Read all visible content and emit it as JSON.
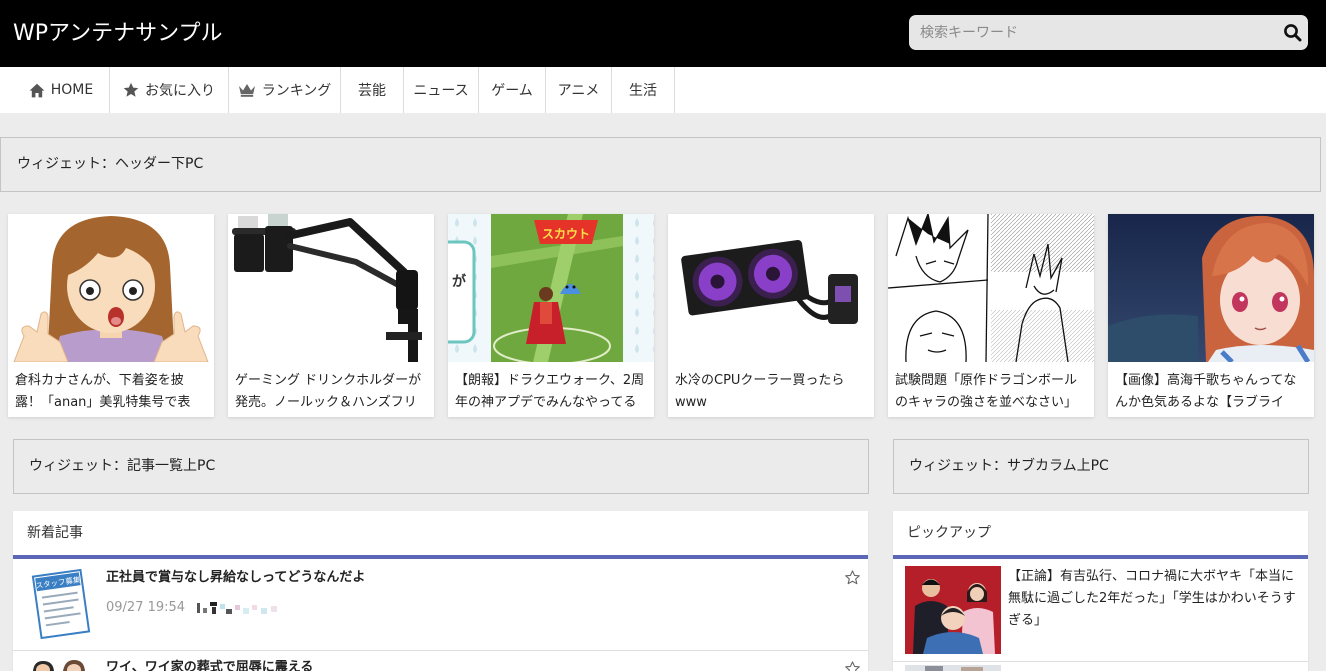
{
  "header": {
    "site_title": "WPアンテナサンプル",
    "search_placeholder": "検索キーワード",
    "search_icon": "search-icon"
  },
  "nav": {
    "items": [
      {
        "label": "HOME",
        "icon": "home-icon"
      },
      {
        "label": "お気に入り",
        "icon": "star-icon"
      },
      {
        "label": "ランキング",
        "icon": "crown-icon"
      },
      {
        "label": "芸能"
      },
      {
        "label": "ニュース"
      },
      {
        "label": "ゲーム"
      },
      {
        "label": "アニメ"
      },
      {
        "label": "生活"
      }
    ]
  },
  "widgets": {
    "header_below": "ウィジェット：ヘッダー下PC",
    "list_above": "ウィジェット：記事一覧上PC",
    "subcolumn_above": "ウィジェット：サブカラム上PC"
  },
  "cards": [
    {
      "title": "倉科カナさんが、下着姿を披露！「anan」美乳特集号で表"
    },
    {
      "title": "ゲーミング ドリンクホルダーが発売。ノールック＆ハンズフリーで給"
    },
    {
      "title": "【朗報】ドラクエウォーク、2周年の神アプデでみんなやってる",
      "image_text": {
        "banner": "スカウト",
        "side": "が"
      }
    },
    {
      "title": "水冷のCPUクーラー買ったらwww"
    },
    {
      "title": "試験問題「原作ドラゴンボールのキャラの強さを並べなさい」"
    },
    {
      "title": "【画像】高海千歌ちゃんってなんか色気あるよな【ラブライブ！サン"
    }
  ],
  "new_articles": {
    "heading": "新着記事",
    "items": [
      {
        "title": "正社員で賞与なし昇給なしってどうなんだよ",
        "datetime": "09/27 19:54",
        "thumb_text": "スタッフ募集",
        "favorite_icon": "star-outline-icon"
      },
      {
        "title": "ワイ、ワイ家の葬式で屈辱に震える",
        "favorite_icon": "star-outline-icon"
      }
    ]
  },
  "pickup": {
    "heading": "ピックアップ",
    "items": [
      {
        "title": "【正論】有吉弘行、コロナ禍に大ボヤキ「本当に無駄に過ごした2年だった」「学生はかわいそうすぎる」"
      }
    ]
  },
  "colors": {
    "header_bg": "#000000",
    "page_bg": "#ececec",
    "accent": "#5b68b7",
    "text": "#222222"
  }
}
